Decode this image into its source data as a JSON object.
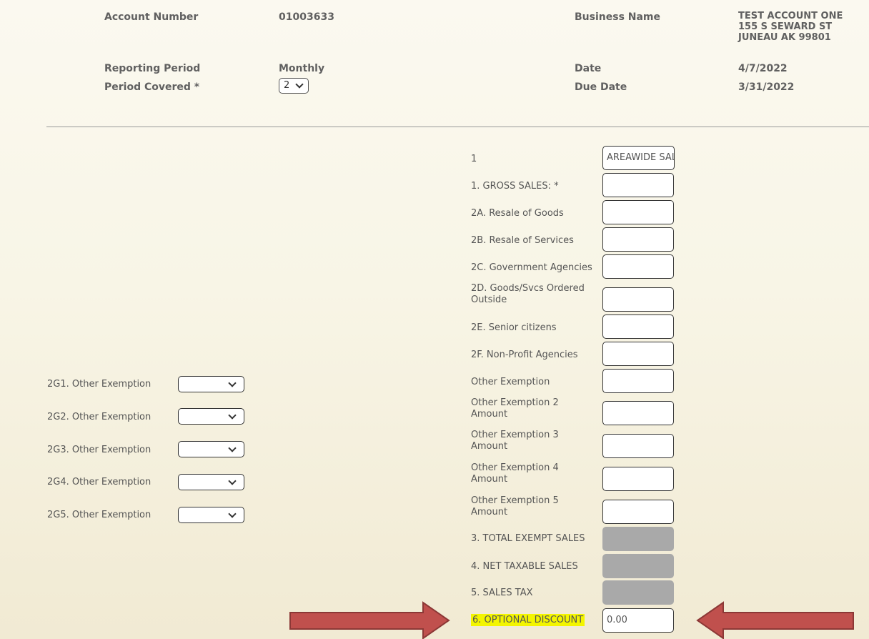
{
  "header": {
    "account_number_label": "Account Number",
    "account_number_value": "01003633",
    "business_name_label": "Business Name",
    "business_name_lines": [
      "TEST ACCOUNT ONE",
      "155 S SEWARD ST",
      "JUNEAU AK 99801"
    ],
    "reporting_period_label": "Reporting Period",
    "reporting_period_value": "Monthly",
    "date_label": "Date",
    "date_value": "4/7/2022",
    "period_covered_label": "Period Covered *",
    "period_covered_selected": "2",
    "due_date_label": "Due Date",
    "due_date_value": "3/31/2022"
  },
  "form": {
    "fields": [
      {
        "label": "1",
        "value": "AREAWIDE SALES"
      },
      {
        "label": "1. GROSS SALES: *",
        "value": ""
      },
      {
        "label": "2A. Resale of Goods",
        "value": ""
      },
      {
        "label": "2B. Resale of Services",
        "value": ""
      },
      {
        "label": "2C. Government Agencies",
        "value": ""
      },
      {
        "label": "2D. Goods/Svcs Ordered Outside",
        "value": ""
      },
      {
        "label": "2E. Senior citizens",
        "value": ""
      },
      {
        "label": "2F. Non-Profit Agencies",
        "value": ""
      },
      {
        "label": "Other Exemption",
        "value": ""
      },
      {
        "label": "Other Exemption 2 Amount",
        "value": ""
      },
      {
        "label": "Other Exemption 3 Amount",
        "value": ""
      },
      {
        "label": "Other Exemption 4 Amount",
        "value": ""
      },
      {
        "label": "Other Exemption 5 Amount",
        "value": ""
      },
      {
        "label": "3. TOTAL EXEMPT SALES",
        "value": ""
      },
      {
        "label": "4. NET TAXABLE SALES",
        "value": ""
      },
      {
        "label": "5. SALES TAX",
        "value": ""
      },
      {
        "label": "6. OPTIONAL DISCOUNT",
        "value": "0.00"
      }
    ],
    "other_exemptions": [
      {
        "label": "2G1. Other Exemption",
        "selected": ""
      },
      {
        "label": "2G2. Other Exemption",
        "selected": ""
      },
      {
        "label": "2G3. Other Exemption",
        "selected": ""
      },
      {
        "label": "2G4. Other Exemption",
        "selected": ""
      },
      {
        "label": "2G5. Other Exemption",
        "selected": ""
      }
    ]
  },
  "colors": {
    "background_top": "#fbf9f0",
    "background_bottom": "#f1ead3",
    "highlight": "#f3f500",
    "arrow_fill": "#c0504d",
    "arrow_stroke": "#8c3836",
    "disabled_field": "#a9a9a9"
  },
  "icons": {
    "dropdown": "chevron-down-icon",
    "annotation": "arrow-right-icon / arrow-left-icon"
  }
}
